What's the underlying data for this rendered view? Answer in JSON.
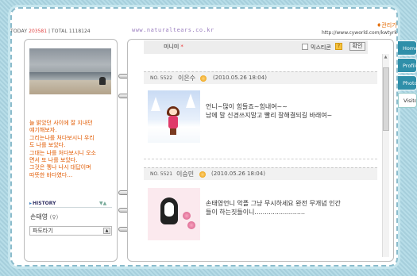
{
  "header": {
    "today_label": "TODAY",
    "today_value": "203581",
    "total_label": "TOTAL",
    "total_value": "1118124",
    "site_text": "www.naturaltears.co.kr",
    "edit_label": "관리기",
    "cy_url": "http://www.cyworld.com/kwtyrk"
  },
  "profile": {
    "intro": "늘 밝았던 사이에 잘 지내던\n얘기해보자.\n그리는나를 처다보시니 우리\n도 나를 보았다.\n그대는 나를 처다보시니 오소\n면서 또 나를 보았다.\n그것은 퀭나 나시 대답이며\n따뜻한 바다였다…",
    "history_label": "HISTORY",
    "owner_name": "손태영",
    "owner_gender": "(♀)",
    "dropdown_value": "파도타기"
  },
  "guestbook": {
    "minimi_label": "미니미",
    "mix_label": "믹스티콘",
    "help_label": "?",
    "confirm_label": "확인",
    "posts": [
      {
        "no_label": "NO.",
        "no": "5522",
        "author": "이은수",
        "date": "(2010.05.26 18:04)",
        "text": "언니~많이 힘들죠~힘내여~~\n남에 말 신경쓰지말고 빨리 잘해결되길 바래여~"
      },
      {
        "no_label": "NO.",
        "no": "5521",
        "author": "이승민",
        "date": "(2010.05.26 18:04)",
        "text": "손태영언니 악플 그냥 무시하세요 완전 무개념 인간\n들이 하는짓들이니........................."
      }
    ]
  },
  "side_tabs": [
    "Home",
    "Profile",
    "Photo",
    "Visitor"
  ]
}
